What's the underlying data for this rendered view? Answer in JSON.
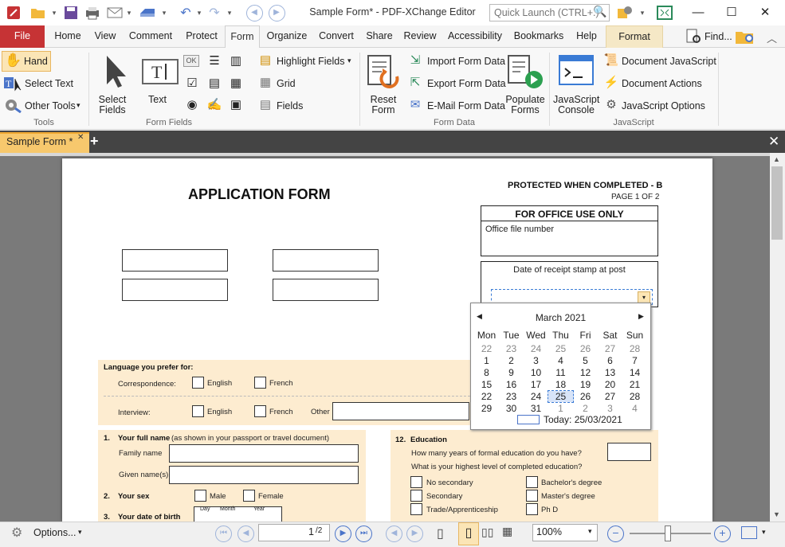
{
  "titlebar": {
    "title": "Sample Form* - PDF-XChange Editor",
    "quick_launch_placeholder": "Quick Launch (CTRL+.)",
    "minimize": "—",
    "maximize": "☐",
    "close": "✕"
  },
  "menu": {
    "file": "File",
    "tabs": [
      "Home",
      "View",
      "Comment",
      "Protect",
      "Form",
      "Organize",
      "Convert",
      "Share",
      "Review",
      "Accessibility",
      "Bookmarks",
      "Help",
      "Format"
    ],
    "find": "Find..."
  },
  "ribbon": {
    "tools": {
      "hand": "Hand",
      "select_text": "Select Text",
      "other_tools": "Other Tools",
      "group": "Tools"
    },
    "form_fields": {
      "select_fields_line1": "Select",
      "select_fields_line2": "Fields",
      "text": "Text",
      "ok": "OK",
      "group": "Form Fields"
    },
    "highlight": {
      "highlight_fields": "Highlight Fields",
      "grid": "Grid",
      "fields": "Fields"
    },
    "form_data": {
      "reset_line1": "Reset",
      "reset_line2": "Form",
      "import": "Import Form Data",
      "export": "Export Form Data",
      "email": "E-Mail Form Data",
      "populate_line1": "Populate",
      "populate_line2": "Forms",
      "group": "Form Data"
    },
    "javascript": {
      "console_line1": "JavaScript",
      "console_line2": "Console",
      "document_js": "Document JavaScript",
      "document_actions": "Document Actions",
      "js_options": "JavaScript Options",
      "group": "JavaScript"
    }
  },
  "doc_tab": {
    "label": "Sample Form *",
    "close": "✕"
  },
  "form": {
    "protected": "PROTECTED WHEN COMPLETED - B",
    "page_of": "PAGE 1 OF 2",
    "title": "APPLICATION FORM",
    "office_use": "FOR OFFICE USE ONLY",
    "office_file_number": "Office file number",
    "date_stamp": "Date of receipt stamp at post",
    "language_heading": "Language you prefer for:",
    "correspondence": "Correspondence:",
    "interview": "Interview:",
    "english": "English",
    "french": "French",
    "other": "Other",
    "q1_num": "1.",
    "q1_label": "Your full name",
    "q1_note": "(as shown in your passport or travel document)",
    "family_name": "Family name",
    "given_names": "Given name(s)",
    "q2_num": "2.",
    "q2_label": "Your sex",
    "male": "Male",
    "female": "Female",
    "q3_num": "3.",
    "q3_label": "Your date of birth",
    "day": "Day",
    "month": "Month",
    "year": "Year",
    "q12_num": "12.",
    "q12_label": "Education",
    "years_question": "How many years of formal education do you have?",
    "level_question": "What is your highest level of completed education?",
    "edu_options_left": [
      "No secondary",
      "Secondary",
      "Trade/Apprenticeship"
    ],
    "edu_options_right": [
      "Bachelor's degree",
      "Master's degree",
      "Ph D"
    ]
  },
  "calendar": {
    "month": "March 2021",
    "weekdays": [
      "Mon",
      "Tue",
      "Wed",
      "Thu",
      "Fri",
      "Sat",
      "Sun"
    ],
    "weeks": [
      [
        "22",
        "23",
        "24",
        "25",
        "26",
        "27",
        "28"
      ],
      [
        "1",
        "2",
        "3",
        "4",
        "5",
        "6",
        "7"
      ],
      [
        "8",
        "9",
        "10",
        "11",
        "12",
        "13",
        "14"
      ],
      [
        "15",
        "16",
        "17",
        "18",
        "19",
        "20",
        "21"
      ],
      [
        "22",
        "23",
        "24",
        "25",
        "26",
        "27",
        "28"
      ],
      [
        "29",
        "30",
        "31",
        "1",
        "2",
        "3",
        "4"
      ]
    ],
    "selected": "25",
    "today": "Today: 25/03/2021"
  },
  "status": {
    "options": "Options...",
    "page_value": "1",
    "page_total": "/2",
    "zoom": "100%"
  },
  "colors": {
    "accent": "#c63335",
    "tab_active": "#f7c86d",
    "form_bg": "#fdecd0"
  }
}
